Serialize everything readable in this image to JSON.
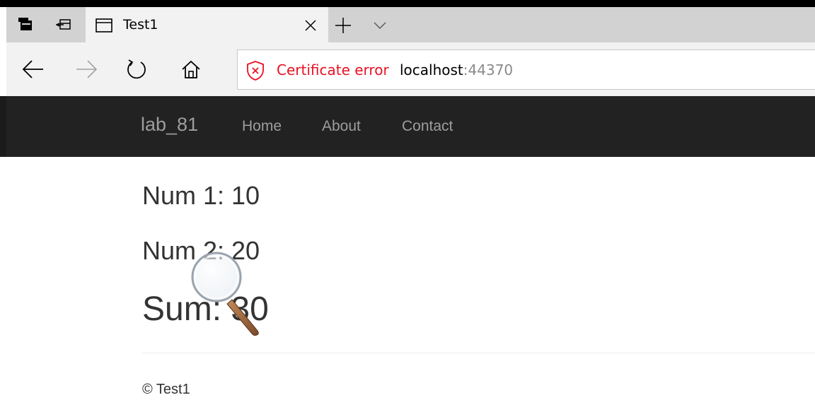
{
  "browser": {
    "tab": {
      "title": "Test1"
    },
    "address_bar": {
      "security_text": "Certificate error",
      "host": "localhost",
      "port": ":44370"
    },
    "icons": {
      "set_aside_tabs": "set-aside-tabs-icon",
      "show_tabs": "show-tabs-icon",
      "tab_page": "page-icon",
      "close_tab": "close-icon",
      "new_tab": "plus-icon",
      "tab_menu": "chevron-down-icon",
      "back": "arrow-left-icon",
      "forward": "arrow-right-icon",
      "refresh": "refresh-icon",
      "home": "home-icon",
      "certificate": "shield-error-icon"
    }
  },
  "site": {
    "brand": "lab_81",
    "nav": [
      {
        "label": "Home"
      },
      {
        "label": "About"
      },
      {
        "label": "Contact"
      }
    ],
    "content": {
      "num1": "Num 1: 10",
      "num2": "Num 2: 20",
      "sum": "Sum: 30"
    },
    "footer": "© Test1"
  },
  "colors": {
    "navbar_bg": "#222222",
    "nav_text": "#9d9d9d",
    "cert_error": "#e81123",
    "body_text": "#333333",
    "tabstrip_bg": "#d2d2d2",
    "toolbar_bg": "#f2f2f2"
  }
}
